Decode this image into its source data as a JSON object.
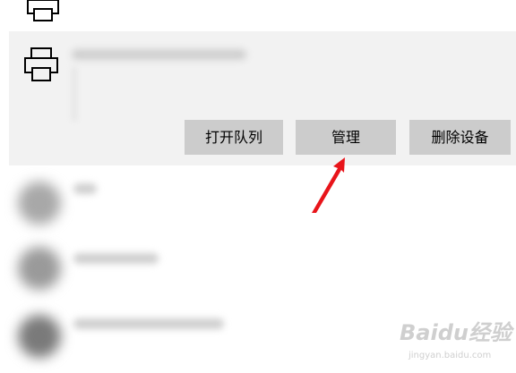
{
  "icons": {
    "printer": "printer-icon",
    "arrow": "red-arrow-annotation"
  },
  "colors": {
    "selected_panel_bg": "#f2f2f2",
    "button_bg": "#cccccc",
    "arrow": "#e8141a"
  },
  "selected_printer": {
    "actions": {
      "open_queue_label": "打开队列",
      "manage_label": "管理",
      "remove_device_label": "删除设备"
    }
  },
  "watermark": {
    "logo": "Baidu经验",
    "url": "jingyan.baidu.com"
  }
}
